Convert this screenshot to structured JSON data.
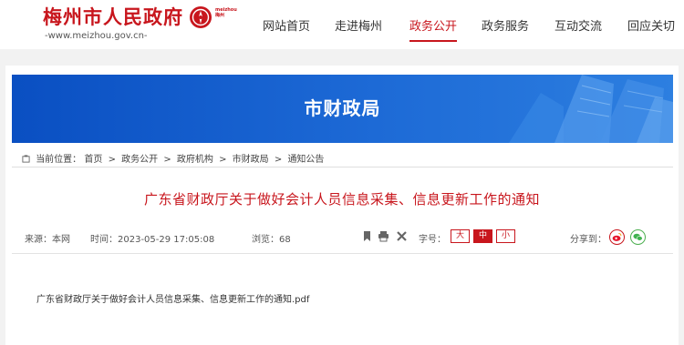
{
  "site": {
    "logo_text": "梅州市人民政府",
    "seal_label_top": "meizhou",
    "seal_label_bottom": "梅州",
    "url": "-www.meizhou.gov.cn-"
  },
  "nav": {
    "items": [
      {
        "label": "网站首页"
      },
      {
        "label": "走进梅州"
      },
      {
        "label": "政务公开",
        "active": true
      },
      {
        "label": "政务服务"
      },
      {
        "label": "互动交流"
      },
      {
        "label": "回应关切"
      }
    ]
  },
  "banner": {
    "title": "市财政局"
  },
  "breadcrumb": {
    "prefix": "当前位置：",
    "items": [
      "首页",
      "政务公开",
      "政府机构",
      "市财政局",
      "通知公告"
    ],
    "separator": ">"
  },
  "article": {
    "title": "广东省财政厅关于做好会计人员信息采集、信息更新工作的通知",
    "source_label": "来源：本网",
    "time_label": "时间：2023-05-29 17:05:08",
    "views_label": "浏览：68",
    "font_size_label": "字号：",
    "font_sizes": {
      "large": "大",
      "medium": "中",
      "small": "小"
    },
    "share_label": "分享到：",
    "attachment": "广东省财政厅关于做好会计人员信息采集、信息更新工作的通知.pdf"
  },
  "icons": {
    "bookmark": "bookmark-icon",
    "print": "print-icon",
    "close": "close-icon",
    "weibo": "weibo-icon",
    "wechat": "wechat-icon",
    "breadcrumb": "location-icon"
  },
  "colors": {
    "brand_red": "#c8161d",
    "banner_blue": "#0a4fc2"
  }
}
